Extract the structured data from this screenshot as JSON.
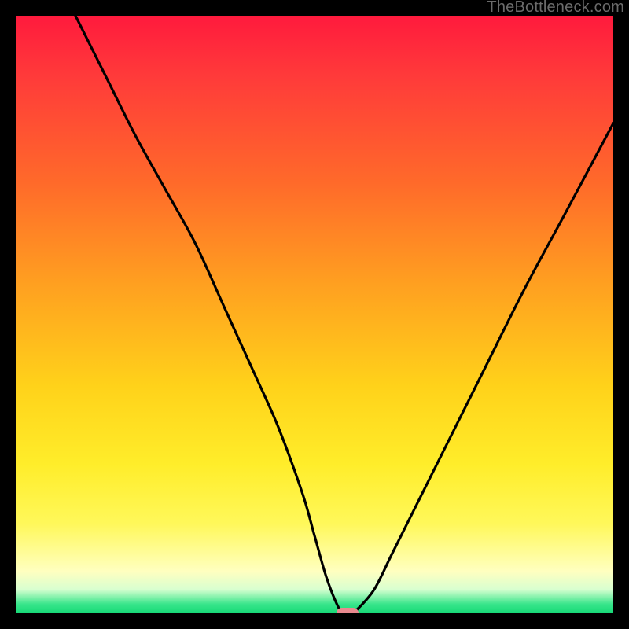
{
  "watermark": "TheBottleneck.com",
  "colors": {
    "frame": "#000000",
    "gradient_top": "#ff1a3d",
    "gradient_mid": "#ffd21a",
    "gradient_low": "#ffffc0",
    "gradient_bottom": "#17d977",
    "curve": "#000000",
    "marker": "#e98a8f"
  },
  "chart_data": {
    "type": "line",
    "title": "",
    "xlabel": "",
    "ylabel": "",
    "xlim": [
      0,
      100
    ],
    "ylim": [
      0,
      100
    ],
    "series": [
      {
        "name": "bottleneck-curve",
        "x": [
          10,
          15,
          20,
          25,
          30,
          35,
          40,
          44,
          48,
          50,
          52,
          54,
          55,
          56,
          57,
          60,
          63,
          67,
          72,
          78,
          85,
          92,
          100
        ],
        "y": [
          100,
          90,
          80,
          71,
          62,
          51,
          40,
          31,
          20,
          13,
          6,
          1,
          0,
          0,
          0.5,
          4,
          10,
          18,
          28,
          40,
          54,
          67,
          82
        ]
      }
    ],
    "marker": {
      "x": 55.5,
      "y": 0
    },
    "grid": false,
    "legend": false
  }
}
